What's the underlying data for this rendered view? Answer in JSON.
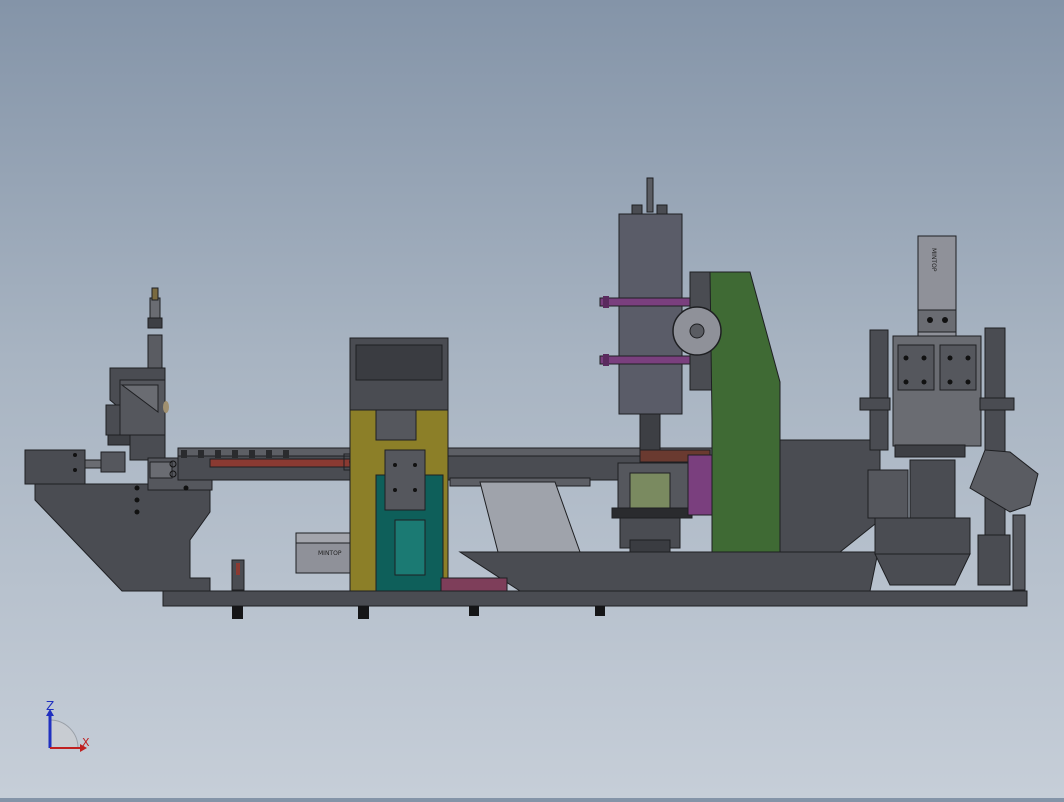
{
  "viewport": {
    "background_top": "#8494a8",
    "background_bottom": "#c6ced8"
  },
  "model": {
    "body_color": "#4a4c52",
    "edge_color": "#1e1f22",
    "light_panel_color": "#8f9199",
    "accent_red": "#8a3a32",
    "accent_olive": "#8c7f28",
    "accent_teal": "#0e5f5a",
    "accent_green": "#3f6a34",
    "accent_purple": "#7a3f7e",
    "accent_pink": "#7e3e5a",
    "cylinder_labels": {
      "left_lower": "MINTOP",
      "right_vertical": "MINTOP"
    }
  },
  "triad": {
    "z_label": "Z",
    "x_label": "X",
    "z_color": "#2030c0",
    "x_color": "#c02020"
  }
}
